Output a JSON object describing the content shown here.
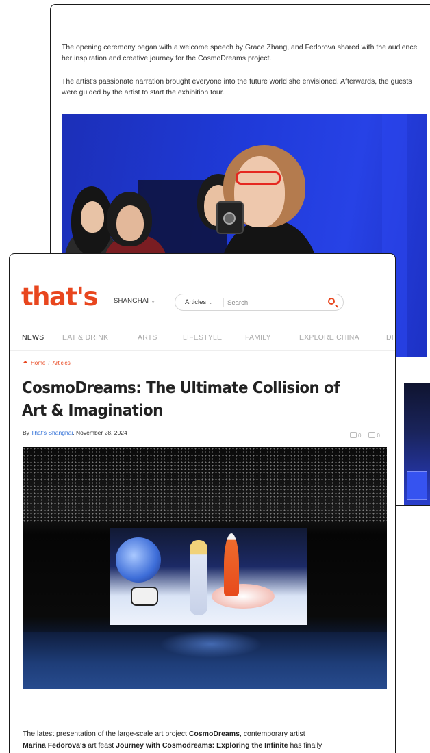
{
  "back_article": {
    "paragraph_1": "The opening ceremony began with a welcome speech by Grace Zhang, and Fedorova shared with the audience her inspiration and creative journey for the CosmoDreams project.",
    "paragraph_2": "The artist's passionate narration brought everyone into the future world she envisioned. Afterwards, the guests were guided by the artist to start the exhibition tour."
  },
  "header": {
    "logo": "that's",
    "city": "SHANGHAI",
    "search": {
      "filter": "Articles",
      "placeholder": "Search"
    }
  },
  "nav": {
    "items": [
      "NEWS",
      "EAT & DRINK",
      "ARTS",
      "LIFESTYLE",
      "FAMILY",
      "EXPLORE CHINA",
      "DI"
    ]
  },
  "breadcrumb": {
    "home": "Home",
    "separator": "/",
    "current": "Articles"
  },
  "article": {
    "title": "CosmoDreams: The Ultimate Collision of Art & Imagination",
    "byline_prefix": "By ",
    "author": "That's Shanghai",
    "date": ", November 28, 2024",
    "share_count": "0",
    "comment_count": "0",
    "body": {
      "t1": "The latest presentation of the large-scale art project ",
      "b1": "CosmoDreams",
      "t2": ", contemporary artist ",
      "b2": "Marina Fedorova's",
      "t3": " art feast ",
      "b3": "Journey with Cosmodreams: Exploring the Infinite",
      "t4": " has finally"
    }
  },
  "colors": {
    "brand": "#e8461e",
    "link": "#2b6cd6"
  }
}
